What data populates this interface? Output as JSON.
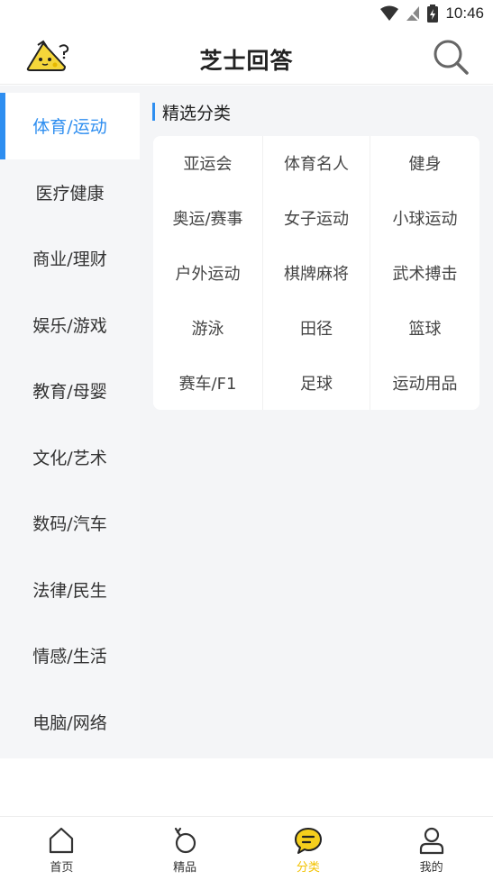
{
  "status_bar": {
    "time": "10:46"
  },
  "header": {
    "title": "芝士回答"
  },
  "sidebar": {
    "items": [
      {
        "label": "体育/运动",
        "active": true
      },
      {
        "label": "医疗健康",
        "active": false
      },
      {
        "label": "商业/理财",
        "active": false
      },
      {
        "label": "娱乐/游戏",
        "active": false
      },
      {
        "label": "教育/母婴",
        "active": false
      },
      {
        "label": "文化/艺术",
        "active": false
      },
      {
        "label": "数码/汽车",
        "active": false
      },
      {
        "label": "法律/民生",
        "active": false
      },
      {
        "label": "情感/生活",
        "active": false
      },
      {
        "label": "电脑/网络",
        "active": false
      }
    ]
  },
  "main": {
    "section_title": "精选分类",
    "categories": [
      "亚运会",
      "体育名人",
      "健身",
      "奥运/赛事",
      "女子运动",
      "小球运动",
      "户外运动",
      "棋牌麻将",
      "武术搏击",
      "游泳",
      "田径",
      "篮球",
      "赛车/F1",
      "足球",
      "运动用品"
    ]
  },
  "bottom_nav": {
    "items": [
      {
        "label": "首页",
        "icon": "home-icon",
        "active": false
      },
      {
        "label": "精品",
        "icon": "medal-icon",
        "active": false
      },
      {
        "label": "分类",
        "icon": "chat-bubble-icon",
        "active": true
      },
      {
        "label": "我的",
        "icon": "user-icon",
        "active": false
      }
    ]
  },
  "colors": {
    "accent": "#2e8ef0",
    "nav_active": "#f2c200",
    "background": "#f4f5f7"
  }
}
